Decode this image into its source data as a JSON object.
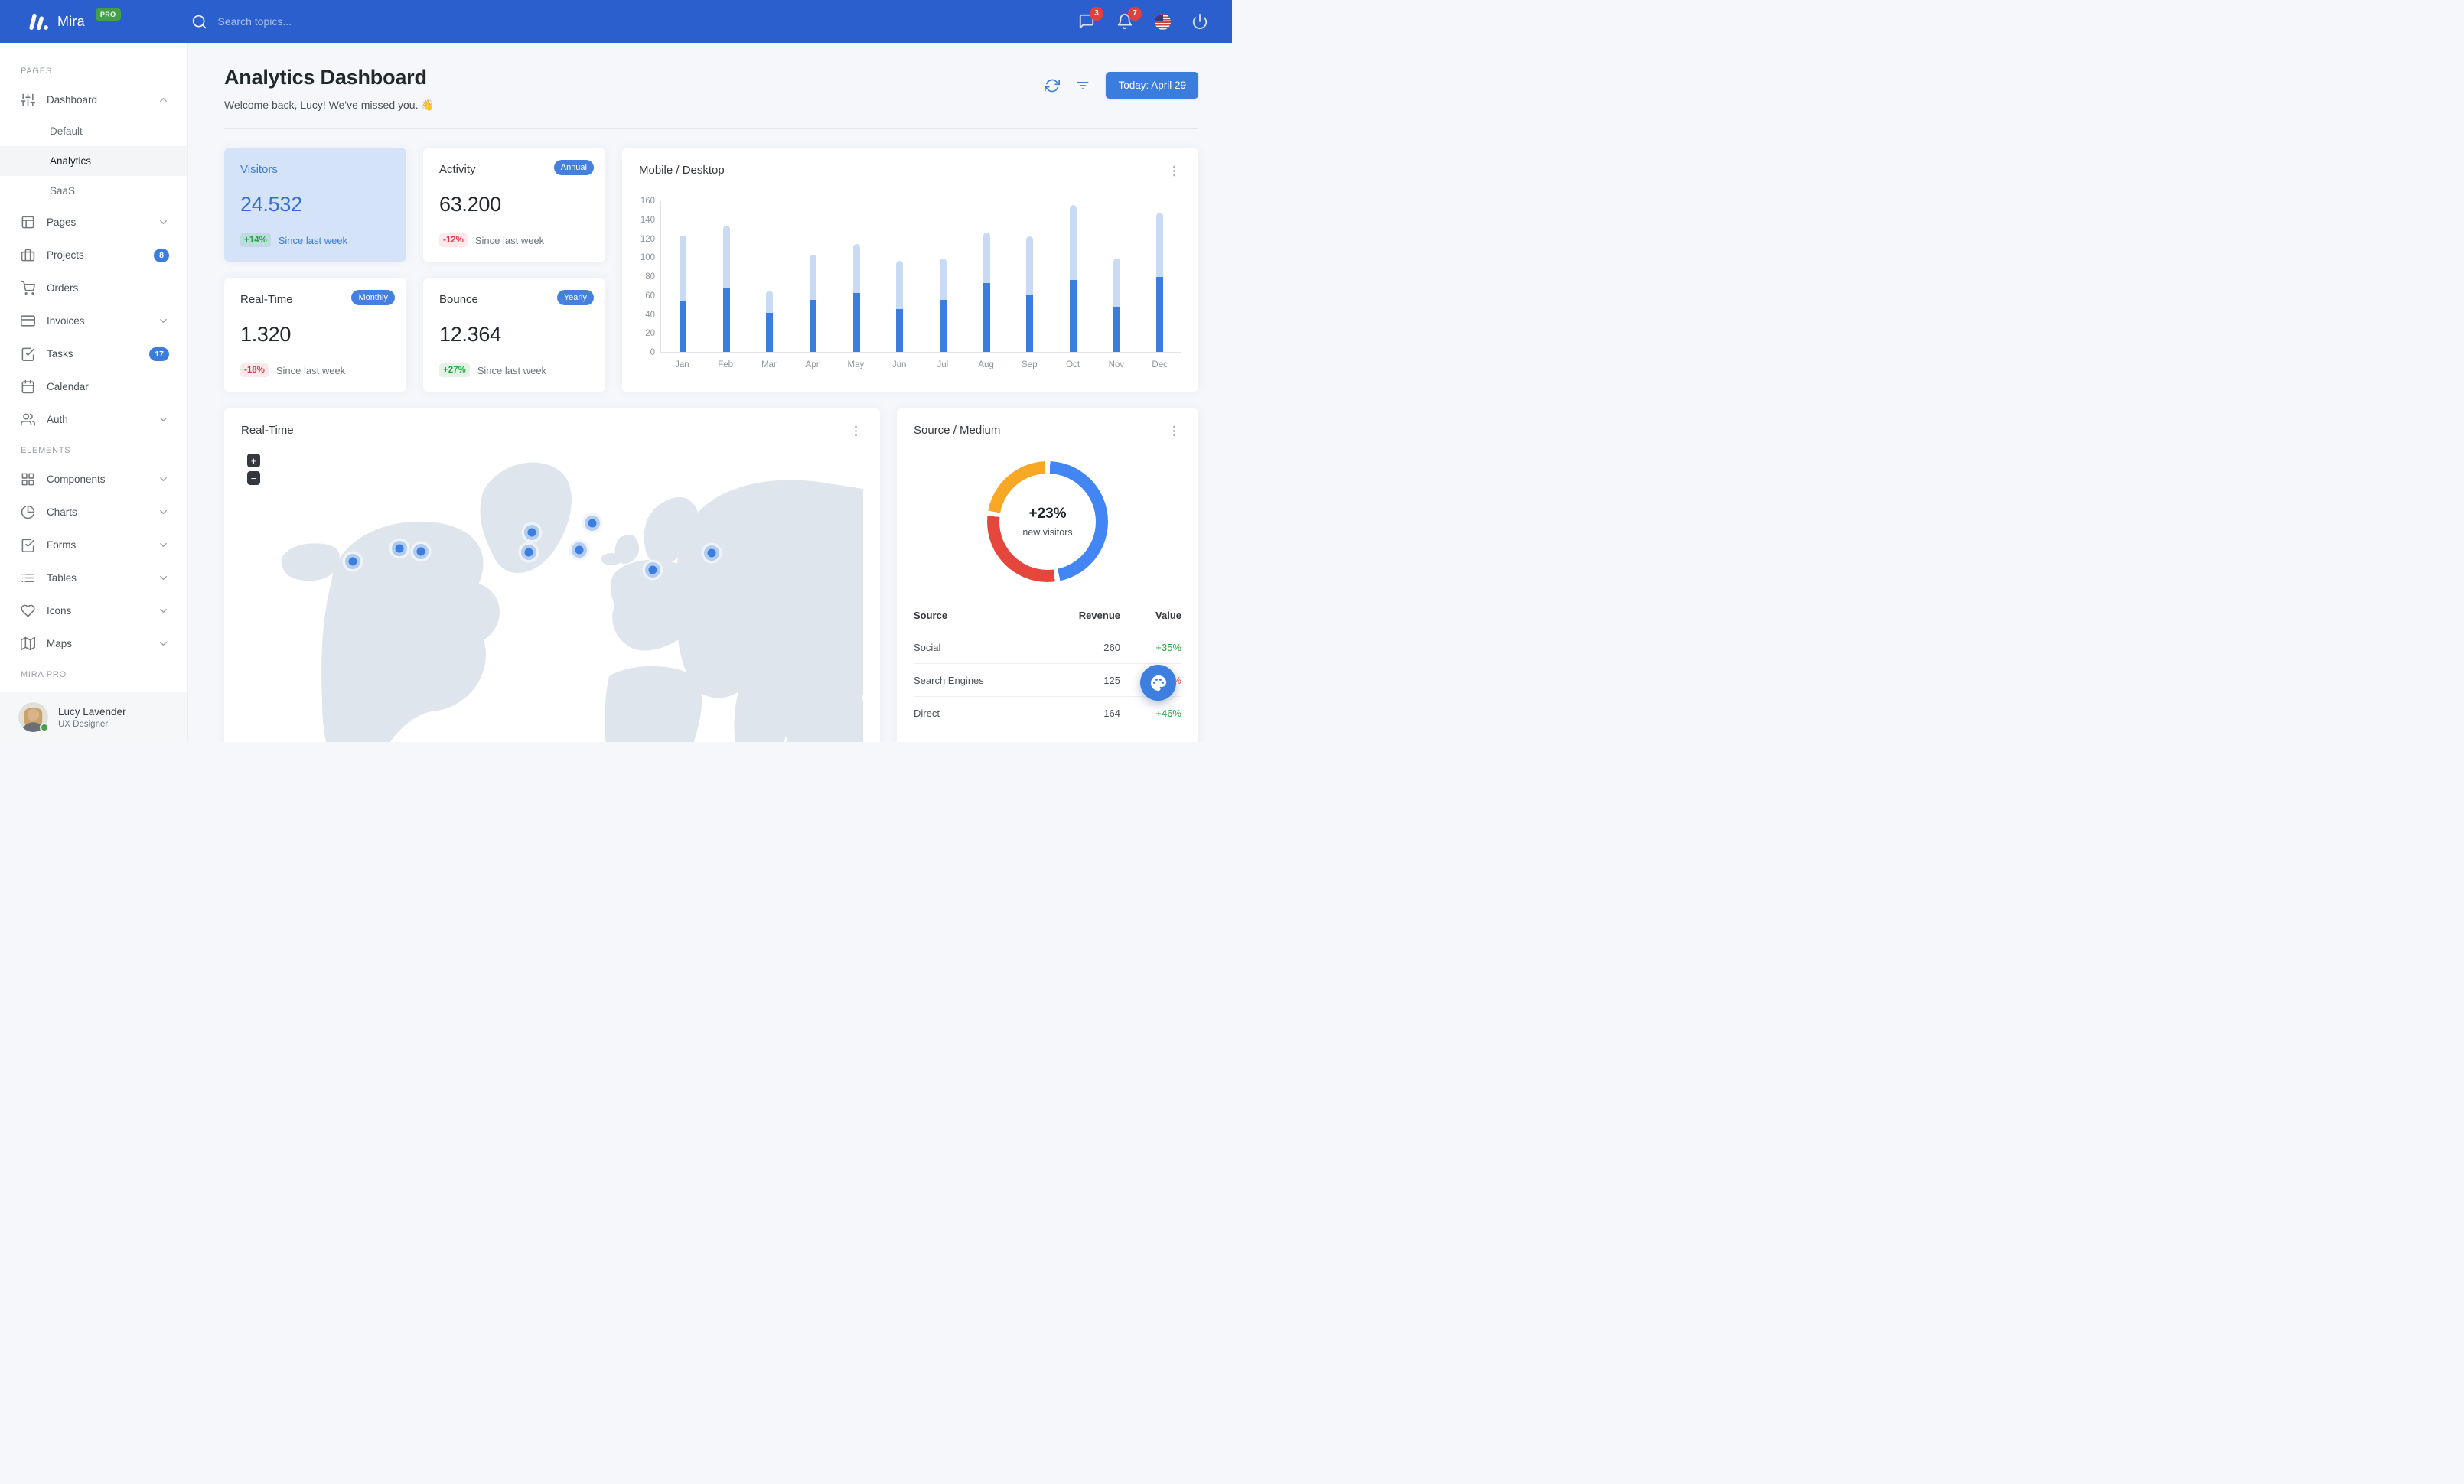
{
  "navbar": {
    "brand": "Mira",
    "brand_badge": "PRO",
    "search_placeholder": "Search topics...",
    "messages_badge": "3",
    "alerts_badge": "7"
  },
  "sidebar": {
    "sections": [
      {
        "label": "PAGES",
        "items": [
          {
            "label": "Dashboard",
            "icon": "sliders",
            "chevron": "up"
          },
          {
            "label": "Default",
            "child": true
          },
          {
            "label": "Analytics",
            "child": true,
            "active": true
          },
          {
            "label": "SaaS",
            "child": true
          },
          {
            "label": "Pages",
            "icon": "layout",
            "chevron": "down"
          },
          {
            "label": "Projects",
            "icon": "briefcase",
            "badge": "8"
          },
          {
            "label": "Orders",
            "icon": "shopping-cart"
          },
          {
            "label": "Invoices",
            "icon": "credit-card",
            "chevron": "down"
          },
          {
            "label": "Tasks",
            "icon": "check-square",
            "badge": "17"
          },
          {
            "label": "Calendar",
            "icon": "calendar"
          },
          {
            "label": "Auth",
            "icon": "users",
            "chevron": "down"
          }
        ]
      },
      {
        "label": "ELEMENTS",
        "items": [
          {
            "label": "Components",
            "icon": "grid",
            "chevron": "down"
          },
          {
            "label": "Charts",
            "icon": "pie-chart",
            "chevron": "down"
          },
          {
            "label": "Forms",
            "icon": "check-square",
            "chevron": "down"
          },
          {
            "label": "Tables",
            "icon": "list",
            "chevron": "down"
          },
          {
            "label": "Icons",
            "icon": "heart",
            "chevron": "down"
          },
          {
            "label": "Maps",
            "icon": "map",
            "chevron": "down"
          }
        ]
      },
      {
        "label": "MIRA PRO",
        "items": []
      }
    ],
    "user": {
      "name": "Lucy Lavender",
      "role": "UX Designer"
    }
  },
  "header": {
    "title": "Analytics Dashboard",
    "subtitle": "Welcome back, Lucy! We've missed you. 👋",
    "today_button": "Today: April 29"
  },
  "stat_cards": [
    {
      "title": "Visitors",
      "value": "24.532",
      "change": "+14%",
      "change_type": "success",
      "note": "Since last week",
      "highlighted": true
    },
    {
      "title": "Activity",
      "pill": "Annual",
      "value": "63.200",
      "change": "-12%",
      "change_type": "danger",
      "note": "Since last week"
    },
    {
      "title": "Real-Time",
      "pill": "Monthly",
      "value": "1.320",
      "change": "-18%",
      "change_type": "danger",
      "note": "Since last week"
    },
    {
      "title": "Bounce",
      "pill": "Yearly",
      "value": "12.364",
      "change": "+27%",
      "change_type": "success",
      "note": "Since last week"
    }
  ],
  "chart_data": [
    {
      "type": "bar",
      "title": "Mobile / Desktop",
      "stacked": true,
      "categories": [
        "Jan",
        "Feb",
        "Mar",
        "Apr",
        "May",
        "Jun",
        "Jul",
        "Aug",
        "Sep",
        "Oct",
        "Nov",
        "Dec"
      ],
      "series": [
        {
          "name": "Mobile",
          "color": "#3B7DDD",
          "values": [
            54,
            67,
            41,
            55,
            62,
            45,
            55,
            73,
            60,
            76,
            48,
            79
          ]
        },
        {
          "name": "Desktop",
          "color": "#C9DAF4",
          "values": [
            69,
            66,
            24,
            48,
            52,
            51,
            44,
            53,
            62,
            79,
            51,
            68
          ]
        }
      ],
      "xlabel": "",
      "ylabel": "",
      "ylim": [
        0,
        160
      ],
      "yticks": [
        160,
        140,
        120,
        100,
        80,
        60,
        40,
        20,
        0
      ],
      "grid": false,
      "legend": "none"
    },
    {
      "type": "pie",
      "title": "Source / Medium",
      "center_label": "+23%",
      "center_sublabel": "new visitors",
      "donut": true,
      "slices": [
        {
          "label": "Social",
          "value": 260,
          "color": "#4285F4"
        },
        {
          "label": "Direct",
          "value": 164,
          "color": "#E5473C"
        },
        {
          "label": "Search Engines",
          "value": 125,
          "color": "#F9A825"
        }
      ]
    },
    {
      "type": "table",
      "columns": [
        "Source",
        "Revenue",
        "Value"
      ],
      "rows": [
        [
          "Social",
          "260",
          "+35%"
        ],
        [
          "Search Engines",
          "125",
          "-12%"
        ],
        [
          "Direct",
          "164",
          "+46%"
        ]
      ],
      "value_types": [
        "success",
        "danger",
        "success"
      ]
    }
  ],
  "map_card": {
    "title": "Real-Time",
    "zoom_in_label": "+",
    "zoom_out_label": "−",
    "markers": [
      {
        "x": 17.9,
        "y": 33.7
      },
      {
        "x": 25.5,
        "y": 30.0
      },
      {
        "x": 28.9,
        "y": 30.9
      },
      {
        "x": 46.8,
        "y": 25.4
      },
      {
        "x": 46.3,
        "y": 31.1
      },
      {
        "x": 54.4,
        "y": 30.4
      },
      {
        "x": 56.4,
        "y": 22.8
      },
      {
        "x": 66.2,
        "y": 36.1
      },
      {
        "x": 75.7,
        "y": 31.3
      }
    ]
  }
}
